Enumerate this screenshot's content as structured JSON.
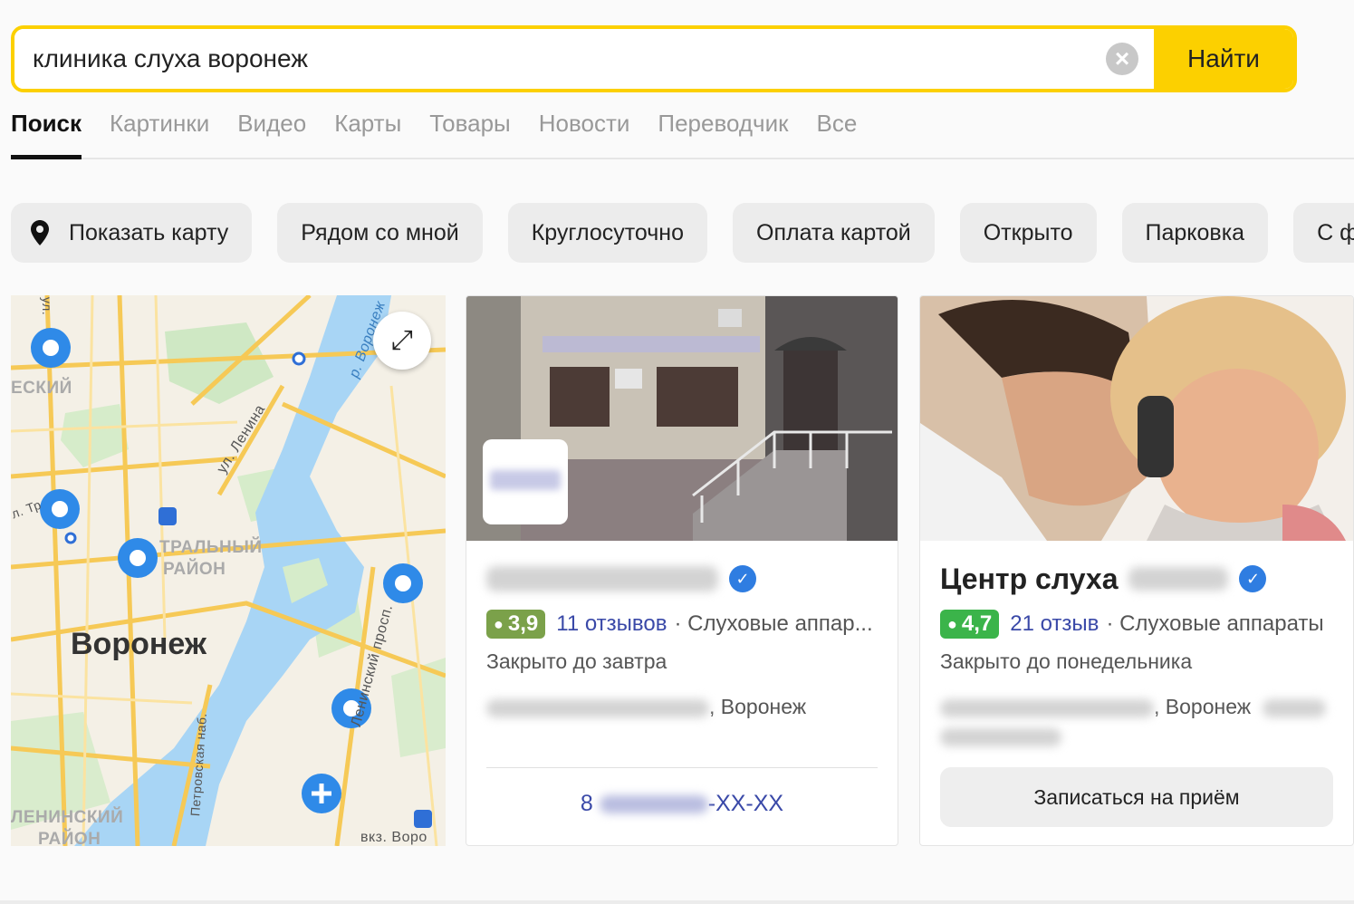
{
  "search": {
    "query": "клиника слуха воронеж",
    "clear_icon": "close-icon",
    "button_label": "Найти"
  },
  "tabs": [
    {
      "label": "Поиск",
      "active": true
    },
    {
      "label": "Картинки"
    },
    {
      "label": "Видео"
    },
    {
      "label": "Карты"
    },
    {
      "label": "Товары"
    },
    {
      "label": "Новости"
    },
    {
      "label": "Переводчик"
    },
    {
      "label": "Все"
    }
  ],
  "filters": [
    {
      "label": "Показать карту",
      "icon": "map-pin-icon"
    },
    {
      "label": "Рядом со мной"
    },
    {
      "label": "Круглосуточно"
    },
    {
      "label": "Оплата картой"
    },
    {
      "label": "Открыто"
    },
    {
      "label": "Парковка"
    },
    {
      "label": "С фото"
    }
  ],
  "map": {
    "city": "Воронеж",
    "labels": {
      "district_central_1": "ТРАЛЬНЫЙ",
      "district_central_2": "РАЙОН",
      "district_lenin_1": "ЛЕНИНСКИЙ",
      "district_lenin_2": "РАЙОН",
      "district_top": "ЕСКИЙ",
      "street_lenina": "ул. Ленина",
      "river": "р. Воронеж",
      "prospect": "Ленинский просп.",
      "embankment": "Петровская наб.",
      "station": "вкз. Воро",
      "street_tr": "л. Тр",
      "street_top": "ул."
    },
    "expand_icon": "expand-icon"
  },
  "cards": [
    {
      "title_blurred": true,
      "rating": "3,9",
      "rating_color": "#7ba14a",
      "reviews": "11 отзывов",
      "category": "· Слуховые аппар...",
      "status": "Закрыто до завтра",
      "address_suffix": ", Воронеж",
      "phone_prefix": "8",
      "phone_suffix": "-XX-XX"
    },
    {
      "title": "Центр слуха",
      "rating": "4,7",
      "rating_color": "#3bb44a",
      "reviews": "21 отзыв",
      "category": "· Слуховые аппараты",
      "status": "Закрыто до понедельника",
      "address_suffix": ", Воронеж",
      "button": "Записаться на приём"
    }
  ],
  "colors": {
    "accent": "#fcd000",
    "link": "#3a49a8",
    "verified": "#2f7de1"
  }
}
